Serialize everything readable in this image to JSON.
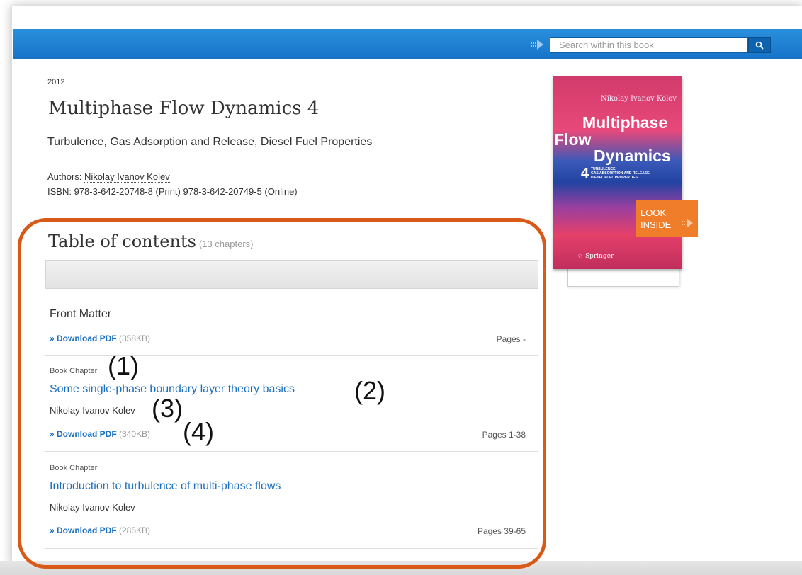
{
  "header": {
    "search_placeholder": "Search within this book"
  },
  "book": {
    "year": "2012",
    "title": "Multiphase Flow Dynamics 4",
    "subtitle": "Turbulence, Gas Adsorption and Release, Diesel Fuel Properties",
    "authors_label": "Authors: ",
    "author_name": "Nikolay Ivanov Kolev",
    "isbn": "ISBN: 978-3-642-20748-8 (Print) 978-3-642-20749-5 (Online)"
  },
  "cover": {
    "author": "Nikolay Ivanov Kolev",
    "title_line1": "Multiphase",
    "title_line2": "Flow",
    "title_line3": "Dynamics",
    "volume": "4",
    "subtitle": "TURBULENCE,\nGAS ABSORPTION AND RELEASE,\nDIESEL FUEL PROPERTIES",
    "publisher": "Springer",
    "look_inside": "LOOK INSIDE",
    "look_inside_color": "#ef7d29"
  },
  "toc": {
    "title": "Table of contents",
    "count": "(13 chapters)",
    "entries": [
      {
        "title": "Front Matter",
        "download": "» Download PDF",
        "size": "(358KB)",
        "pages": "Pages -"
      },
      {
        "type": "Book Chapter",
        "title": "Some single-phase boundary layer theory basics",
        "author": "Nikolay Ivanov Kolev",
        "download": "» Download PDF",
        "size": "(340KB)",
        "pages": "Pages 1-38"
      },
      {
        "type": "Book Chapter",
        "title": "Introduction to turbulence of multi-phase flows",
        "author": "Nikolay Ivanov Kolev",
        "download": "» Download PDF",
        "size": "(285KB)",
        "pages": "Pages 39-65"
      }
    ]
  },
  "annotations": {
    "a1": "(1)",
    "a2": "(2)",
    "a3": "(3)",
    "a4": "(4)",
    "box_color": "#d95a16"
  },
  "colors": {
    "header_blue": "#1673c8",
    "link_blue": "#1b6fc0"
  }
}
